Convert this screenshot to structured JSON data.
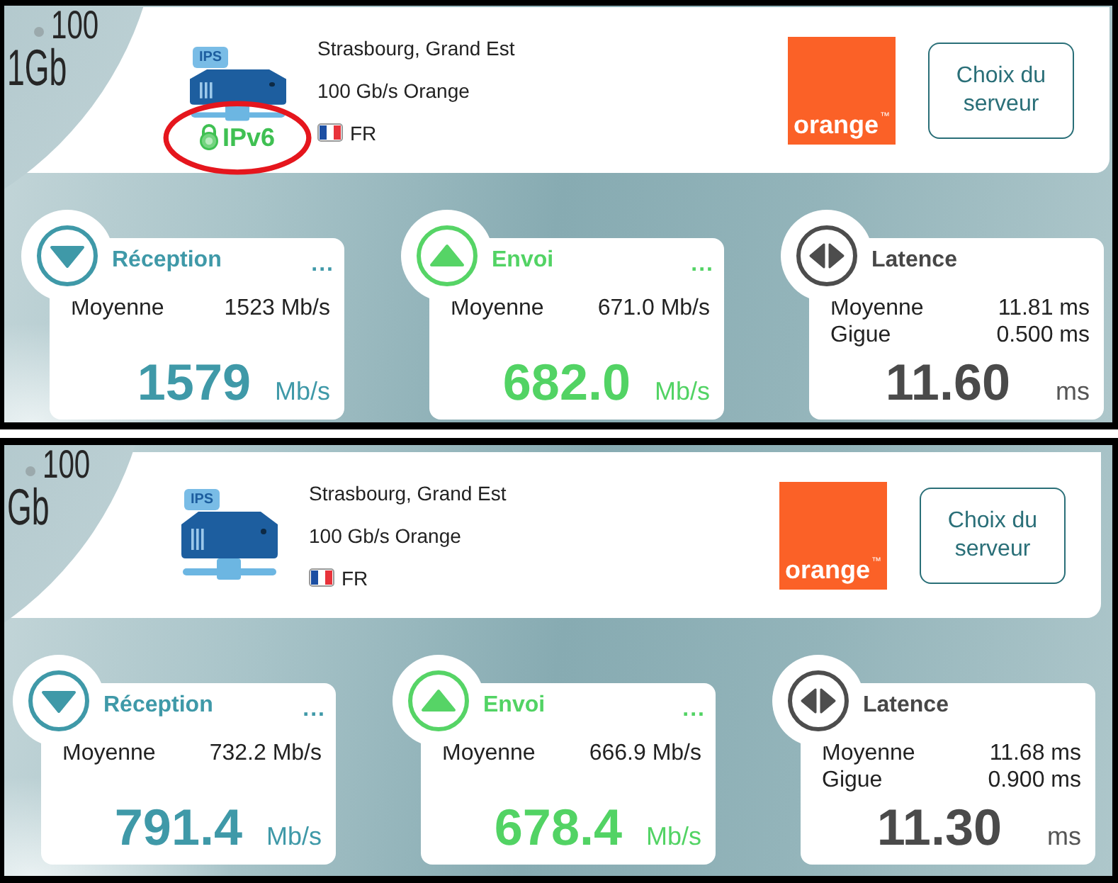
{
  "panels": [
    {
      "gauge": {
        "scale_label": "100",
        "unit_label": "1Gb"
      },
      "server": {
        "tag": "IPS",
        "ipv6_badge": {
          "label": "IPv6",
          "circled": true
        },
        "location": "Strasbourg, Grand Est",
        "provider": "100 Gb/s Orange",
        "country": "FR"
      },
      "provider_logo": {
        "wordmark": "orange",
        "trademark": "™"
      },
      "server_button": "Choix du serveur",
      "metrics": [
        {
          "kind": "download",
          "title": "Réception",
          "menu": "...",
          "rows": [
            {
              "label": "Moyenne",
              "value": "1523 Mb/s"
            }
          ],
          "value": "1579",
          "unit": "Mb/s"
        },
        {
          "kind": "upload",
          "title": "Envoi",
          "menu": "...",
          "rows": [
            {
              "label": "Moyenne",
              "value": "671.0 Mb/s"
            }
          ],
          "value": "682.0",
          "unit": "Mb/s"
        },
        {
          "kind": "latency",
          "title": "Latence",
          "rows": [
            {
              "label": "Moyenne",
              "value": "11.81 ms"
            },
            {
              "label": "Gigue",
              "value": "0.500 ms"
            }
          ],
          "value": "11.60",
          "unit": "ms"
        }
      ]
    },
    {
      "gauge": {
        "scale_label": "100",
        "unit_label": "Gb"
      },
      "server": {
        "tag": "IPS",
        "location": "Strasbourg, Grand Est",
        "provider": "100 Gb/s Orange",
        "country": "FR"
      },
      "provider_logo": {
        "wordmark": "orange",
        "trademark": "™"
      },
      "server_button": "Choix du serveur",
      "metrics": [
        {
          "kind": "download",
          "title": "Réception",
          "menu": "...",
          "rows": [
            {
              "label": "Moyenne",
              "value": "732.2 Mb/s"
            }
          ],
          "value": "791.4",
          "unit": "Mb/s"
        },
        {
          "kind": "upload",
          "title": "Envoi",
          "menu": "...",
          "rows": [
            {
              "label": "Moyenne",
              "value": "666.9 Mb/s"
            }
          ],
          "value": "678.4",
          "unit": "Mb/s"
        },
        {
          "kind": "latency",
          "title": "Latence",
          "rows": [
            {
              "label": "Moyenne",
              "value": "11.68 ms"
            },
            {
              "label": "Gigue",
              "value": "0.900 ms"
            }
          ],
          "value": "11.30",
          "unit": "ms"
        }
      ]
    }
  ]
}
